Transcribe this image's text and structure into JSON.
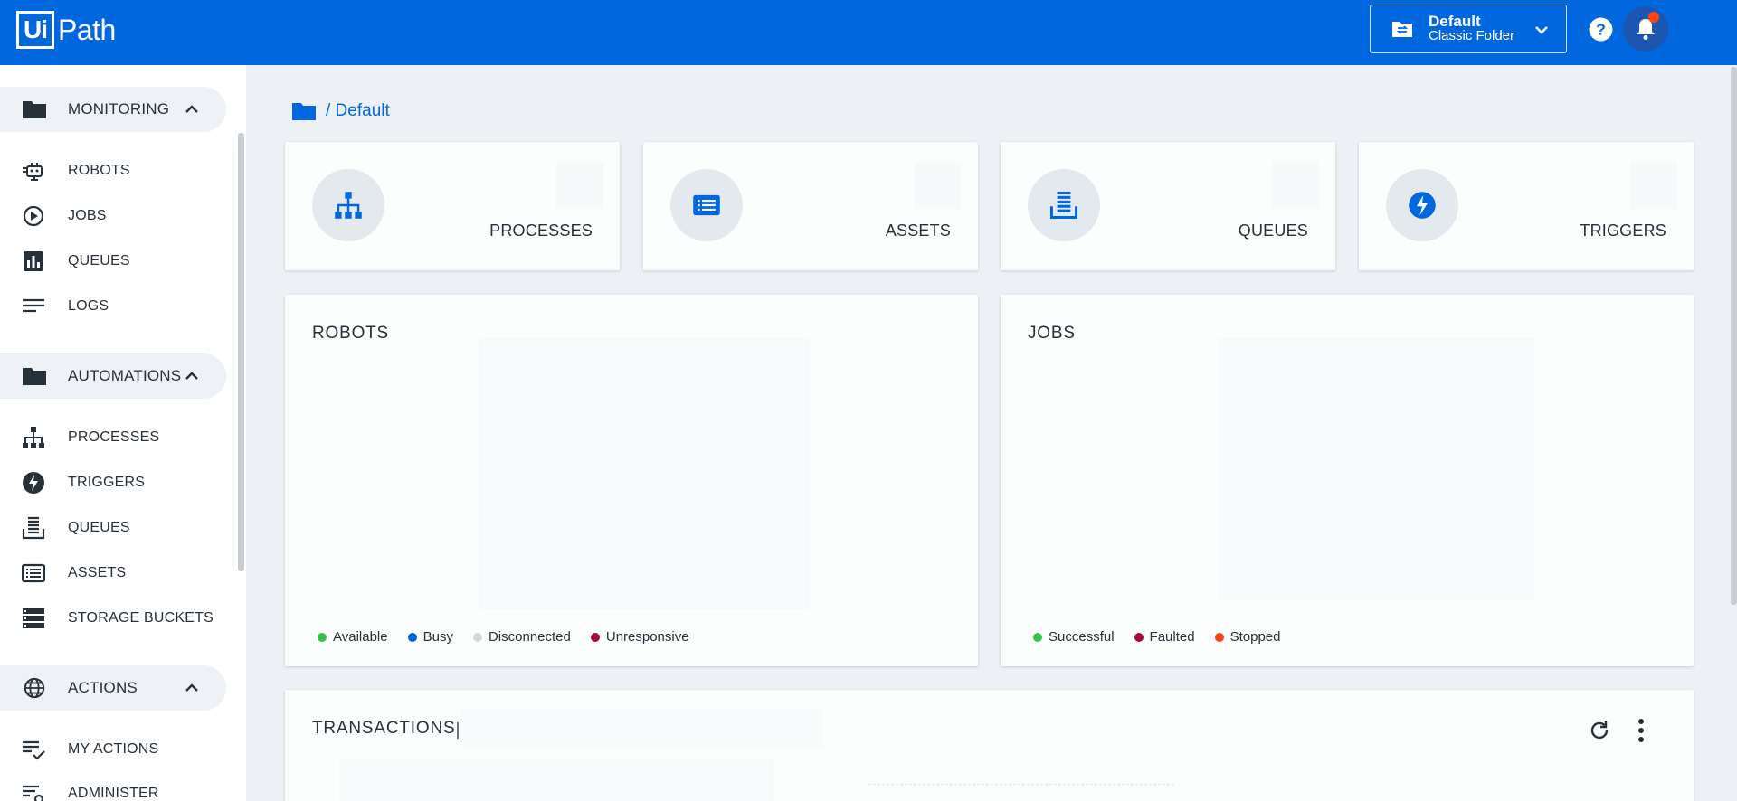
{
  "header": {
    "logo_box": "Ui",
    "logo_text": "Path",
    "folder": {
      "title": "Default",
      "subtitle": "Classic Folder"
    }
  },
  "sidebar": {
    "monitoring": {
      "label": "MONITORING",
      "items": [
        {
          "label": "ROBOTS",
          "icon": "robot-icon"
        },
        {
          "label": "JOBS",
          "icon": "play-circle-icon"
        },
        {
          "label": "QUEUES",
          "icon": "bar-chart-icon"
        },
        {
          "label": "LOGS",
          "icon": "lines-icon"
        }
      ]
    },
    "automations": {
      "label": "AUTOMATIONS",
      "items": [
        {
          "label": "PROCESSES",
          "icon": "hierarchy-icon"
        },
        {
          "label": "TRIGGERS",
          "icon": "bolt-icon"
        },
        {
          "label": "QUEUES",
          "icon": "queue-stack-icon"
        },
        {
          "label": "ASSETS",
          "icon": "list-box-icon"
        },
        {
          "label": "STORAGE BUCKETS",
          "icon": "server-icon"
        }
      ]
    },
    "actions": {
      "label": "ACTIONS",
      "items": [
        {
          "label": "MY ACTIONS",
          "icon": "checklist-icon"
        },
        {
          "label": "ADMINISTER",
          "icon": "settings-list-icon"
        }
      ]
    }
  },
  "breadcrumb": {
    "text": "/ Default"
  },
  "tiles": [
    {
      "label": "PROCESSES",
      "icon": "hierarchy-icon"
    },
    {
      "label": "ASSETS",
      "icon": "list-box-icon"
    },
    {
      "label": "QUEUES",
      "icon": "queue-stack-icon"
    },
    {
      "label": "TRIGGERS",
      "icon": "bolt-icon"
    }
  ],
  "robots_chart": {
    "title": "ROBOTS",
    "legend": [
      {
        "label": "Available",
        "color": "#38c14c"
      },
      {
        "label": "Busy",
        "color": "#0067df"
      },
      {
        "label": "Disconnected",
        "color": "#cfd8dd"
      },
      {
        "label": "Unresponsive",
        "color": "#a6093d"
      }
    ]
  },
  "jobs_chart": {
    "title": "JOBS",
    "legend": [
      {
        "label": "Successful",
        "color": "#38c14c"
      },
      {
        "label": "Faulted",
        "color": "#a6093d"
      },
      {
        "label": "Stopped",
        "color": "#fa4616"
      }
    ]
  },
  "transactions": {
    "title": "TRANSACTIONS"
  },
  "colors": {
    "brand": "#0067df",
    "background": "#edf1f5",
    "icon": "#273139"
  }
}
